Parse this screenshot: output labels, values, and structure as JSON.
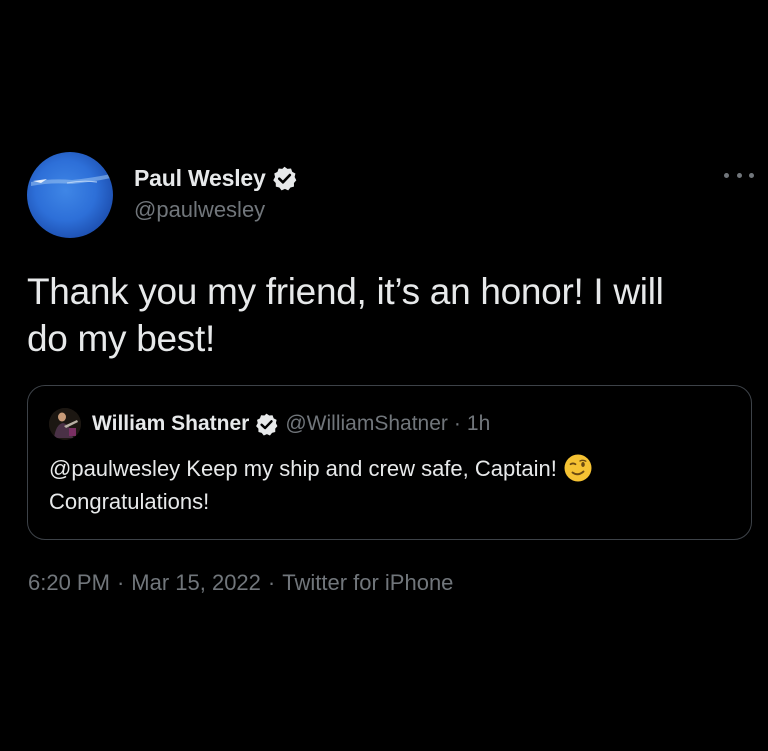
{
  "author": {
    "display_name": "Paul Wesley",
    "handle": "@paulwesley",
    "verified_icon": "verified-badge-icon"
  },
  "more_icon": "more-options-icon",
  "tweet": {
    "text_line1": "Thank you my friend, it’s an honor! I will",
    "text_line2": "do my best!"
  },
  "quoted_tweet": {
    "display_name": "William Shatner",
    "handle": "@WilliamShatner",
    "separator": "·",
    "time": "1h",
    "text_line1": "@paulwesley Keep my ship and crew safe, Captain!",
    "emoji": "winking-face-emoji",
    "text_line2": "Congratulations!"
  },
  "meta": {
    "time": "6:20 PM",
    "date": "Mar 15, 2022",
    "source": "Twitter for iPhone",
    "separator": "·"
  },
  "colors": {
    "background": "#000000",
    "primary_text": "#e7e9ea",
    "secondary_text": "#71767b",
    "border": "#3d4248"
  }
}
